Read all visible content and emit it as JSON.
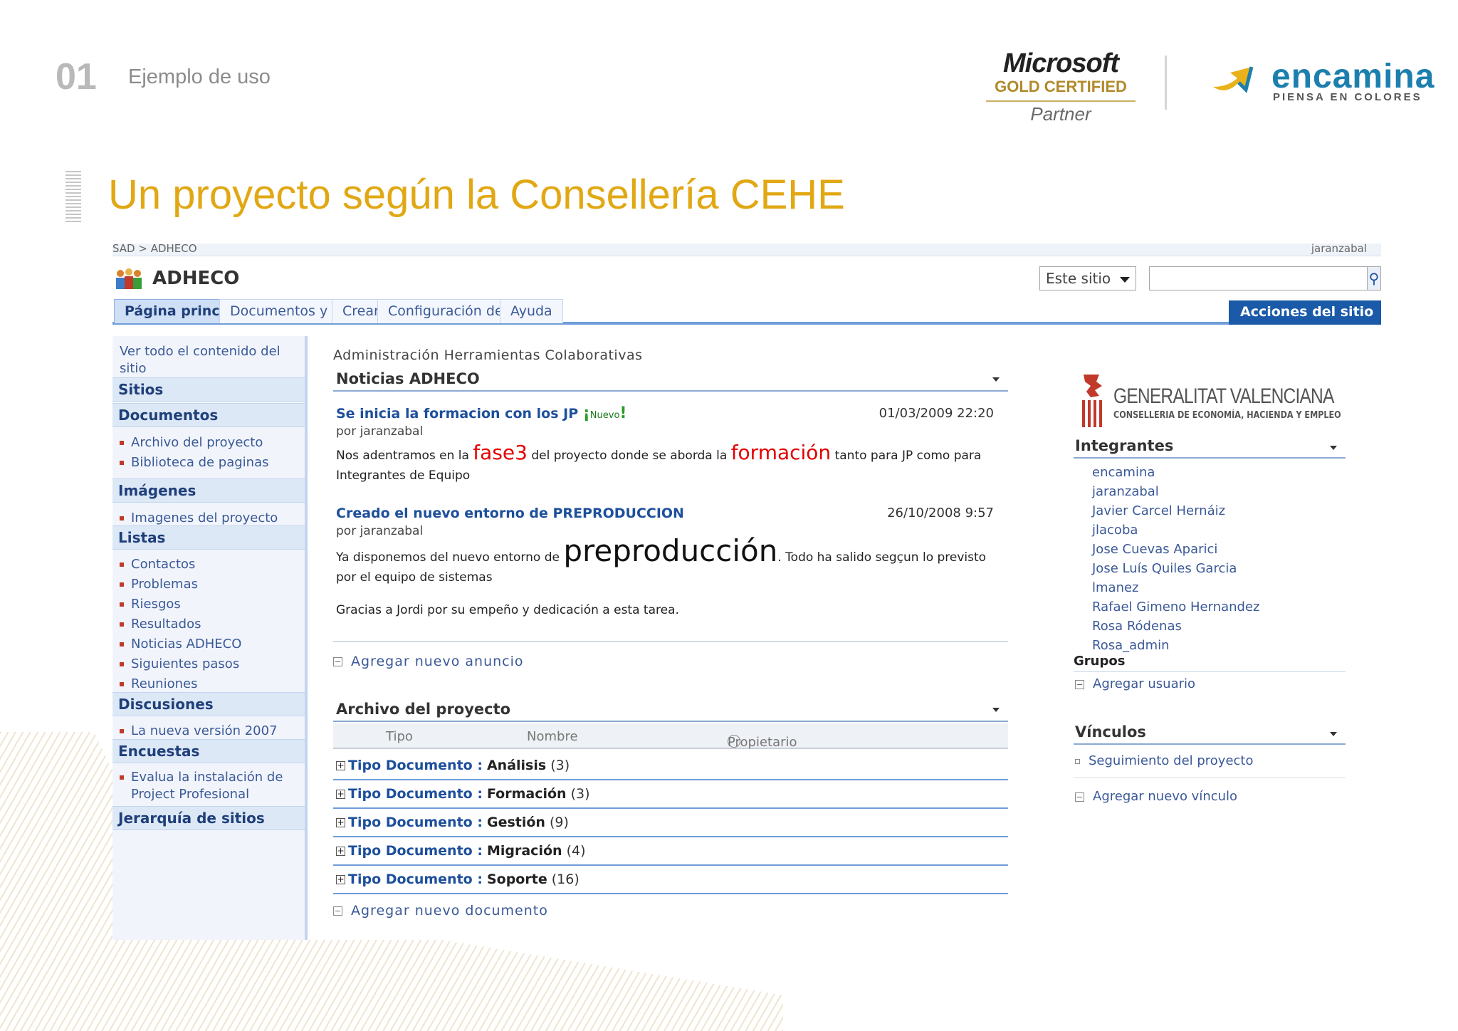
{
  "slide": {
    "number": "01",
    "subtitle": "Ejemplo de uso",
    "title": "Un proyecto según la Consellería CEHE"
  },
  "logos": {
    "ms_word": "Microsoft",
    "ms_gold": "GOLD CERTIFIED",
    "ms_partner": "Partner",
    "encamina_word": "encamina",
    "encamina_tag": "PIENSA EN COLORES"
  },
  "sharepoint": {
    "breadcrumb": "SAD > ADHECO",
    "user": "jaranzabal",
    "site_title": "ADHECO",
    "search_scope": "Este sitio",
    "search_placeholder": "",
    "tabs": [
      "Página principal",
      "Documentos y listas",
      "Crear",
      "Configuración del sitio",
      "Ayuda"
    ],
    "site_actions": "Acciones del sitio",
    "left_nav": {
      "view_all": [
        "Ver todo el contenido del",
        "sitio"
      ],
      "sitios": "Sitios",
      "documentos": "Documentos",
      "doc_items": [
        "Archivo del proyecto",
        "Biblioteca de paginas"
      ],
      "imagenes": "Imágenes",
      "img_items": [
        "Imagenes del proyecto"
      ],
      "listas": "Listas",
      "list_items": [
        "Contactos",
        "Problemas",
        "Riesgos",
        "Resultados",
        "Noticias ADHECO",
        "Siguientes pasos",
        "Reuniones"
      ],
      "discusiones": "Discusiones",
      "disc_items": [
        "La nueva versión 2007"
      ],
      "encuestas": "Encuestas",
      "enc_items": [
        "Evalua la instalación de",
        "Project Profesional"
      ],
      "jerarquia": "Jerarquía de sitios"
    },
    "main": {
      "description": "Administración Herramientas Colaborativas",
      "news_header": "Noticias ADHECO",
      "news": [
        {
          "title": "Se inicia la formacion con los JP",
          "nuevo": "Nuevo",
          "date": "01/03/2009 22:20",
          "by": "por jaranzabal",
          "body_a": "Nos adentramos en la ",
          "body_b": "fase3",
          "body_c": " del proyecto donde se aborda la ",
          "body_d": "formación",
          "body_e": " tanto para JP como para",
          "body_f": "Integrantes de Equipo"
        },
        {
          "title": "Creado el nuevo entorno de PREPRODUCCION",
          "date": "26/10/2008 9:57",
          "by": "por jaranzabal",
          "body_a": "Ya disponemos del nuevo entorno de ",
          "body_b": "preproducción",
          "body_c": ". Todo ha salido segçun lo previsto",
          "body_d": "por el equipo de sistemas",
          "body_e": "Gracias a Jordi por su empeño y dedicación a esta tarea."
        }
      ],
      "add_news": "Agregar nuevo anuncio",
      "archive_header": "Archivo del proyecto",
      "columns": [
        "Tipo",
        "Nombre",
        "Propietario"
      ],
      "groups": [
        {
          "key": "Tipo Documento :",
          "value": "Análisis",
          "count": "(3)"
        },
        {
          "key": "Tipo Documento :",
          "value": "Formación",
          "count": "(3)"
        },
        {
          "key": "Tipo Documento :",
          "value": "Gestión",
          "count": "(9)"
        },
        {
          "key": "Tipo Documento :",
          "value": "Migración",
          "count": "(4)"
        },
        {
          "key": "Tipo Documento :",
          "value": "Soporte",
          "count": "(16)"
        }
      ],
      "add_doc": "Agregar nuevo documento"
    },
    "right": {
      "gv_name": "GENERALITAT VALENCIANA",
      "gv_dept": "CONSELLERIA DE ECONOMÍA, HACIENDA Y EMPLEO",
      "members_header": "Integrantes",
      "members": [
        "encamina",
        "jaranzabal",
        "Javier Carcel Hernáiz",
        "jlacoba",
        "Jose Cuevas Aparici",
        "Jose Luís Quiles Garcia",
        "lmanez",
        "Rafael Gimeno Hernandez",
        "Rosa Ródenas",
        "Rosa_admin"
      ],
      "groups_label": "Grupos",
      "add_user": "Agregar usuario",
      "links_header": "Vínculos",
      "links": [
        "Seguimiento del proyecto"
      ],
      "add_link": "Agregar nuevo vínculo"
    }
  },
  "colors": {
    "title": "#e1a814",
    "sp_blue": "#1a5aa8",
    "link": "#3b5998",
    "red_emphasis": "#e30000"
  }
}
